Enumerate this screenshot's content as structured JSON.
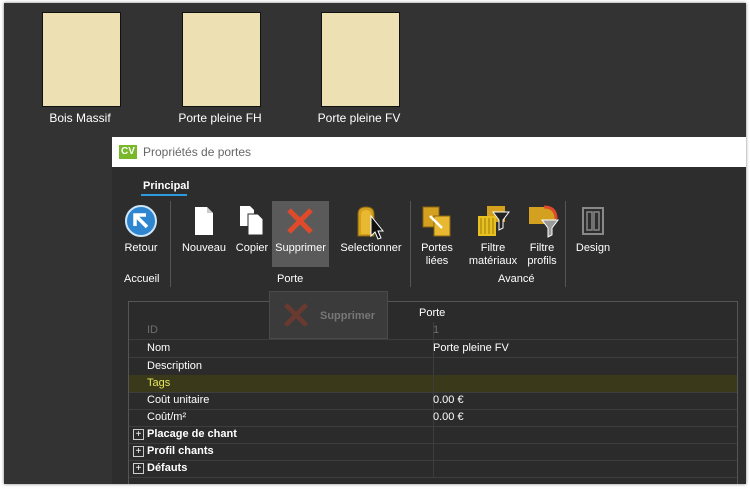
{
  "library": {
    "items": [
      {
        "label": "Bois Massif"
      },
      {
        "label": "Porte pleine FH"
      },
      {
        "label": "Porte pleine FV"
      }
    ]
  },
  "window": {
    "logo": "CV",
    "title": "Propriétés de portes"
  },
  "ribbon": {
    "tab": "Principal",
    "groups": {
      "accueil": "Accueil",
      "porte": "Porte",
      "avance": "Avancé"
    },
    "buttons": {
      "retour": "Retour",
      "nouveau": "Nouveau",
      "copier": "Copier",
      "supprimer": "Supprimer",
      "selectionner": "Selectionner",
      "portes_liees_1": "Portes",
      "portes_liees_2": "liées",
      "filtre_mat_1": "Filtre",
      "filtre_mat_2": "matériaux",
      "filtre_prof_1": "Filtre",
      "filtre_prof_2": "profils",
      "design": "Design"
    }
  },
  "drag_ghost": {
    "label": "Supprimer"
  },
  "grid": {
    "header": "Porte",
    "rows": [
      {
        "name": "ID",
        "value": "1"
      },
      {
        "name": "Nom",
        "value": "Porte pleine FV"
      },
      {
        "name": "Description",
        "value": ""
      },
      {
        "name": "Tags",
        "value": ""
      },
      {
        "name": "Coût unitaire",
        "value": "0.00 €"
      },
      {
        "name": "Coût/m²",
        "value": "0.00 €"
      }
    ],
    "groups": [
      {
        "name": "Placage de chant"
      },
      {
        "name": "Profil chants"
      },
      {
        "name": "Défauts"
      }
    ]
  },
  "colors": {
    "background": "#333333",
    "thumbnail": "#ede0b2",
    "accent": "#2e9be0",
    "logo": "#78b82a",
    "delete": "#e04a2a",
    "folder": "#d4a020"
  }
}
